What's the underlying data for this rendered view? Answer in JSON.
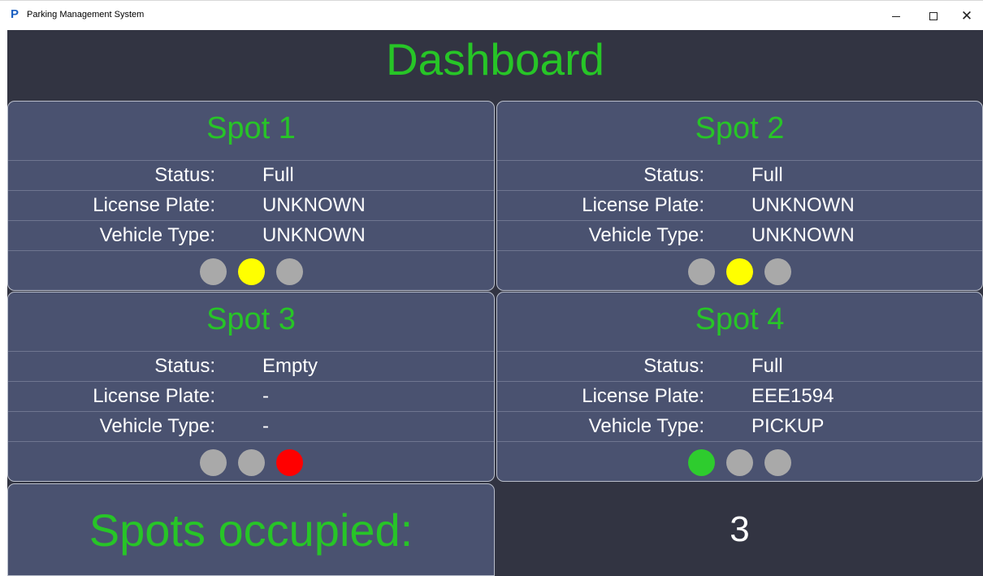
{
  "window": {
    "title": "Parking Management System",
    "icon": "P"
  },
  "dashboard": {
    "title": "Dashboard"
  },
  "labels": {
    "status": "Status:",
    "plate": "License Plate:",
    "type": "Vehicle Type:"
  },
  "spots": [
    {
      "name": "Spot 1",
      "status": "Full",
      "plate": "UNKNOWN",
      "type": "UNKNOWN",
      "lights": [
        "off",
        "yellow",
        "off"
      ]
    },
    {
      "name": "Spot 2",
      "status": "Full",
      "plate": "UNKNOWN",
      "type": "UNKNOWN",
      "lights": [
        "off",
        "yellow",
        "off"
      ]
    },
    {
      "name": "Spot 3",
      "status": "Empty",
      "plate": "-",
      "type": "-",
      "lights": [
        "off",
        "off",
        "red"
      ]
    },
    {
      "name": "Spot 4",
      "status": "Full",
      "plate": "EEE1594",
      "type": "PICKUP",
      "lights": [
        "green",
        "off",
        "off"
      ]
    }
  ],
  "light_colors": {
    "off": "#a9a9a9",
    "yellow": "#ffff00",
    "red": "#ff0000",
    "green": "#2ecc2e"
  },
  "summary": {
    "label": "Spots occupied:",
    "count": "3"
  }
}
